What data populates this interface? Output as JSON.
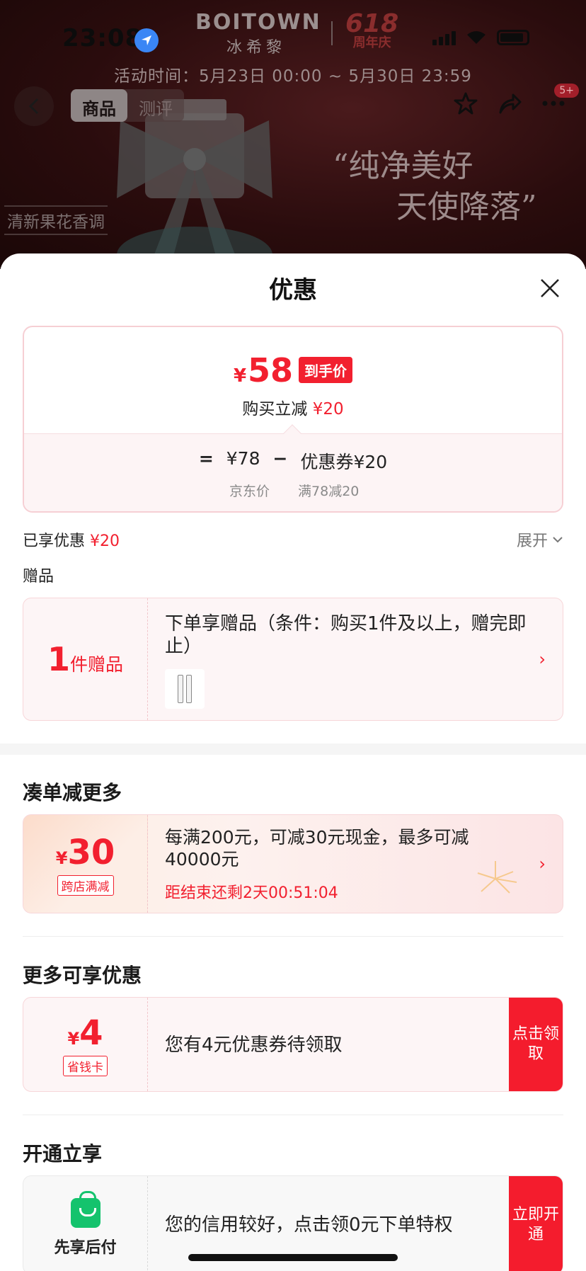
{
  "status_bar": {
    "time": "23:08"
  },
  "brand": {
    "name_en": "BOITOWN",
    "name_cn": "冰希黎",
    "event_num": "618",
    "event_label": "周年庆"
  },
  "activity_time": "活动时间：5月23日 00:00 ~ 5月30日 23:59",
  "nav": {
    "tabs": [
      {
        "label": "商品",
        "active": true
      },
      {
        "label": "测评",
        "active": false
      }
    ],
    "badge": "5+"
  },
  "banner": {
    "slogan_line1": "“纯净美好",
    "slogan_line2": "天使降落”",
    "tagline": "清新果花香调"
  },
  "sheet": {
    "title": "优惠",
    "price": {
      "currency": "¥",
      "final_price": "58",
      "final_tag": "到手价",
      "instant_discount_label": "购买立减",
      "instant_discount_value": "¥20",
      "formula_eq": "=",
      "jd_price": "¥78",
      "formula_minus": "−",
      "coupon_label": "优惠券",
      "coupon_value": "¥20",
      "jd_price_label": "京东价",
      "coupon_rule": "满78减20"
    },
    "enjoyed_label": "已享优惠",
    "enjoyed_value": "¥20",
    "expand_label": "展开",
    "gift_section_label": "赠品",
    "gift": {
      "count": "1",
      "unit": "件赠品",
      "text": "下单享赠品（条件：购买1件及以上，赠完即止）"
    },
    "more_discount": {
      "title": "凑单减更多",
      "currency": "¥",
      "amount": "30",
      "tag": "跨店满减",
      "text": "每满200元，可减30元现金，最多可减40000元",
      "countdown": "距结束还剩2天00:51:04"
    },
    "more_offers": {
      "title": "更多可享优惠",
      "currency": "¥",
      "amount": "4",
      "tag": "省钱卡",
      "text": "您有4元优惠券待领取",
      "action": "点击领取"
    },
    "open_enjoy": {
      "title": "开通立享",
      "label": "先享后付",
      "text": "您的信用较好，点击领0元下单特权",
      "action": "立即开通"
    }
  },
  "colors": {
    "accent_red": "#f2202f",
    "green": "#14c36d"
  }
}
